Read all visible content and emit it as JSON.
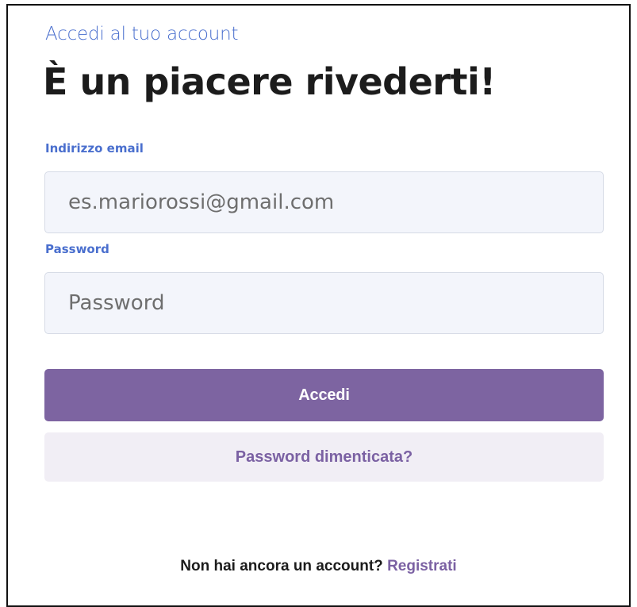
{
  "header": {
    "subtitle": "Accedi al tuo account",
    "title": "È un piacere rivederti!"
  },
  "form": {
    "email": {
      "label": "Indirizzo email",
      "value": "",
      "placeholder": "es.mariorossi@gmail.com"
    },
    "password": {
      "label": "Password",
      "value": "",
      "placeholder": "Password"
    },
    "submit_label": "Accedi",
    "forgot_label": "Password dimenticata?"
  },
  "footer": {
    "prompt": "Non hai ancora un account?",
    "signup_label": "Registrati"
  },
  "colors": {
    "accent_blue": "#4a6fce",
    "primary_purple": "#7d64a1",
    "secondary_bg": "#f1eef5",
    "input_bg": "#f3f5fb",
    "text_dark": "#1c1c1c"
  }
}
